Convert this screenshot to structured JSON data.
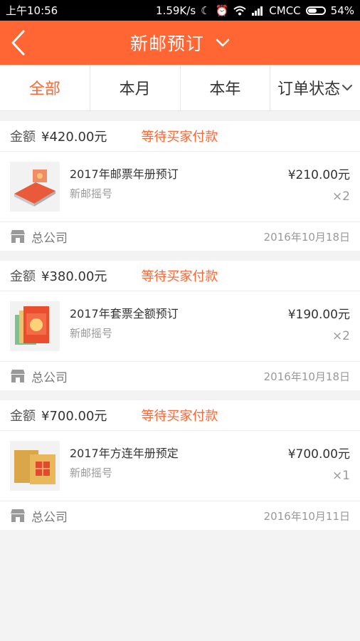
{
  "status_bar": {
    "time": "上午10:56",
    "speed": "1.59K/s",
    "carrier": "CMCC",
    "battery": "54%"
  },
  "header": {
    "title": "新邮预订",
    "back_icon": "chevron-left-icon",
    "dropdown_icon": "chevron-down-icon"
  },
  "tabs": [
    {
      "label": "全部",
      "active": true
    },
    {
      "label": "本月",
      "active": false
    },
    {
      "label": "本年",
      "active": false
    },
    {
      "label": "订单状态",
      "active": false
    }
  ],
  "orders": [
    {
      "amount_label": "金额",
      "amount": "¥420.00元",
      "status": "等待买家付款",
      "product_name": "2017年邮票年册预订",
      "product_sub": "新邮摇号",
      "price": "¥210.00元",
      "qty": "×2",
      "store": "总公司",
      "date": "2016年10月18日"
    },
    {
      "amount_label": "金额",
      "amount": "¥380.00元",
      "status": "等待买家付款",
      "product_name": "2017年套票全额预订",
      "product_sub": "新邮摇号",
      "price": "¥190.00元",
      "qty": "×2",
      "store": "总公司",
      "date": "2016年10月18日"
    },
    {
      "amount_label": "金额",
      "amount": "¥700.00元",
      "status": "等待买家付款",
      "product_name": "2017年方连年册预定",
      "product_sub": "新邮摇号",
      "price": "¥700.00元",
      "qty": "×1",
      "store": "总公司",
      "date": "2016年10月11日"
    }
  ],
  "colors": {
    "accent": "#ff6633",
    "background": "#f3f3f3"
  }
}
